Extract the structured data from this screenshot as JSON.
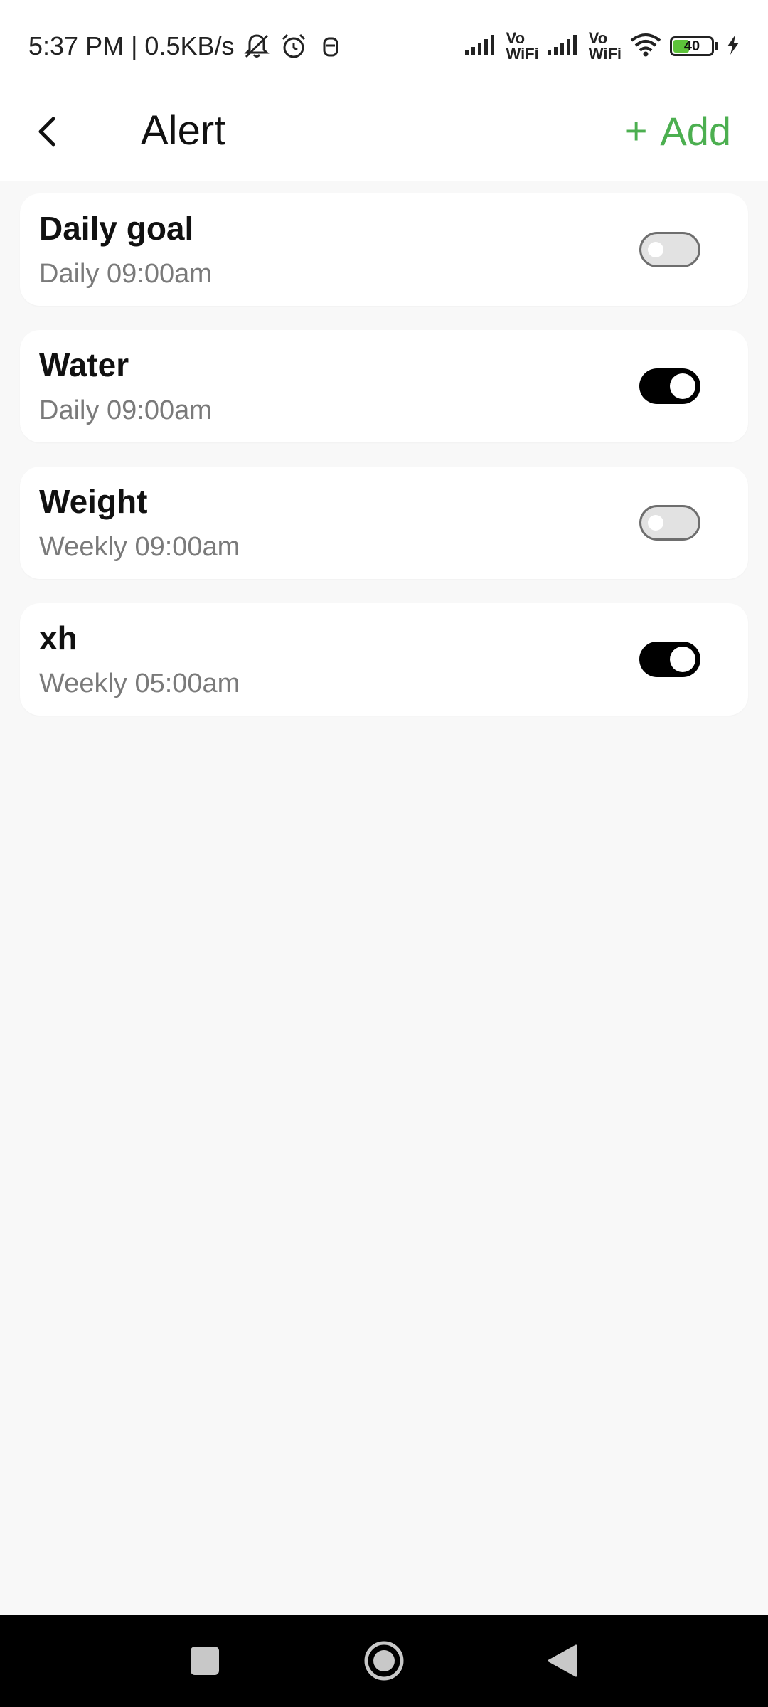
{
  "status_bar": {
    "time_speed": "5:37 PM | 0.5KB/s",
    "vowifi_1": [
      "Vo",
      "WiFi"
    ],
    "vowifi_2": [
      "Vo",
      "WiFi"
    ],
    "battery_level": "40",
    "icons": [
      "bell-muted-icon",
      "alarm-clock-icon",
      "app-notification-icon",
      "signal-icon",
      "signal-icon",
      "wifi-icon",
      "battery-icon",
      "charging-bolt-icon"
    ]
  },
  "header": {
    "title": "Alert",
    "add_plus": "+",
    "add_label": "Add",
    "accent_color": "#4caf50"
  },
  "alerts": [
    {
      "name": "Daily goal",
      "schedule": "Daily 09:00am",
      "enabled": false
    },
    {
      "name": "Water",
      "schedule": "Daily 09:00am",
      "enabled": true
    },
    {
      "name": "Weight",
      "schedule": "Weekly 09:00am",
      "enabled": false
    },
    {
      "name": "xh",
      "schedule": "Weekly 05:00am",
      "enabled": true
    }
  ],
  "nav_bar": {
    "buttons": [
      "recents-square-icon",
      "home-circle-icon",
      "back-triangle-icon"
    ]
  }
}
